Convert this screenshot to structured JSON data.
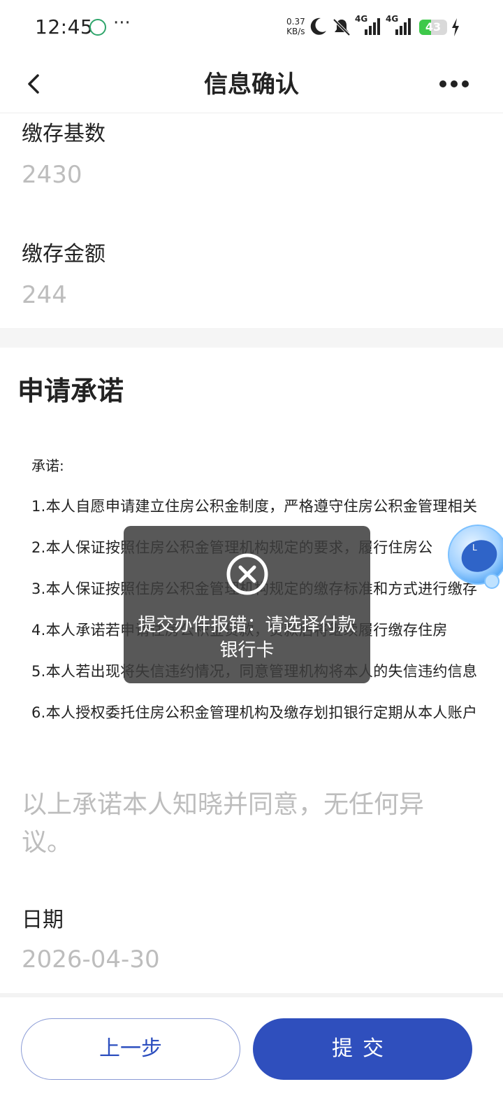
{
  "status_bar": {
    "time": "12:45",
    "dots": "···",
    "net_speed_value": "0.37",
    "net_speed_unit": "KB/s",
    "signal_1": "4G",
    "signal_2": "4G",
    "battery": "43",
    "battery_level": 0.43
  },
  "nav": {
    "title": "信息确认"
  },
  "fields": {
    "base_label": "缴存基数",
    "base_value": "2430",
    "amount_label": "缴存金额",
    "amount_value": "244"
  },
  "commitment": {
    "title": "申请承诺",
    "head": "承诺:",
    "lines": [
      "1.本人自愿申请建立住房公积金制度，严格遵守住房公积金管理相关",
      "2.本人保证按照住房公积金管理机构规定的要求，履行住房公",
      "3.本人保证按照住房公积金管理机构规定的缴存标准和方式进行缴存",
      "4.本人承诺若申请住房公积金贷款，贷款后将继续履行缴存住房",
      "5.本人若出现将失信违约情况，同意管理机构将本人的失信违约信息",
      "6.本人授权委托住房公积金管理机构及缴存划扣银行定期从本人账户"
    ],
    "agree": "以上承诺本人知晓并同意，无任何异议。"
  },
  "date": {
    "label": "日期",
    "value": "2026-04-30"
  },
  "toast": {
    "message": "提交办件报错：请选择付款银行卡"
  },
  "buttons": {
    "prev": "上一步",
    "submit": "提交"
  },
  "colors": {
    "primary": "#2f4fbd",
    "placeholder": "#bdbdbd",
    "battery_green": "#3ec94a"
  }
}
